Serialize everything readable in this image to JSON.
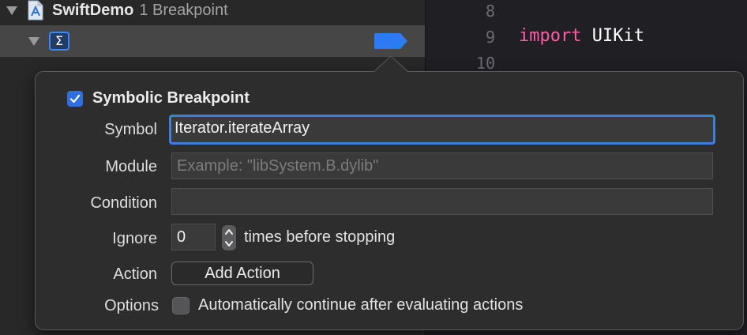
{
  "navigator": {
    "project_name": "SwiftDemo",
    "breakpoint_count": "1 Breakpoint",
    "symbol_icon_glyph": "Σ"
  },
  "editor": {
    "line_numbers": [
      "8",
      "9",
      "10"
    ],
    "code_keyword": "import",
    "code_identifier": "UIKit"
  },
  "breakpoint_editor": {
    "title": "Symbolic Breakpoint",
    "enabled": true,
    "symbol_label": "Symbol",
    "symbol_value": "Iterator.iterateArray",
    "module_label": "Module",
    "module_placeholder": "Example: \"libSystem.B.dylib\"",
    "condition_label": "Condition",
    "condition_value": "",
    "ignore_label": "Ignore",
    "ignore_value": "0",
    "ignore_suffix": "times before stopping",
    "action_label": "Action",
    "add_action_label": "Add Action",
    "options_label": "Options",
    "auto_continue_label": "Automatically continue after evaluating actions",
    "auto_continue_checked": false
  },
  "colors": {
    "accent": "#2f6fe4",
    "keyword": "#fc5fa3",
    "breakpoint_marker": "#2c7bf2"
  },
  "icons": {
    "project": "xcode-project-icon",
    "symbolic_breakpoint": "sigma-icon",
    "breakpoint": "breakpoint-marker-icon"
  }
}
